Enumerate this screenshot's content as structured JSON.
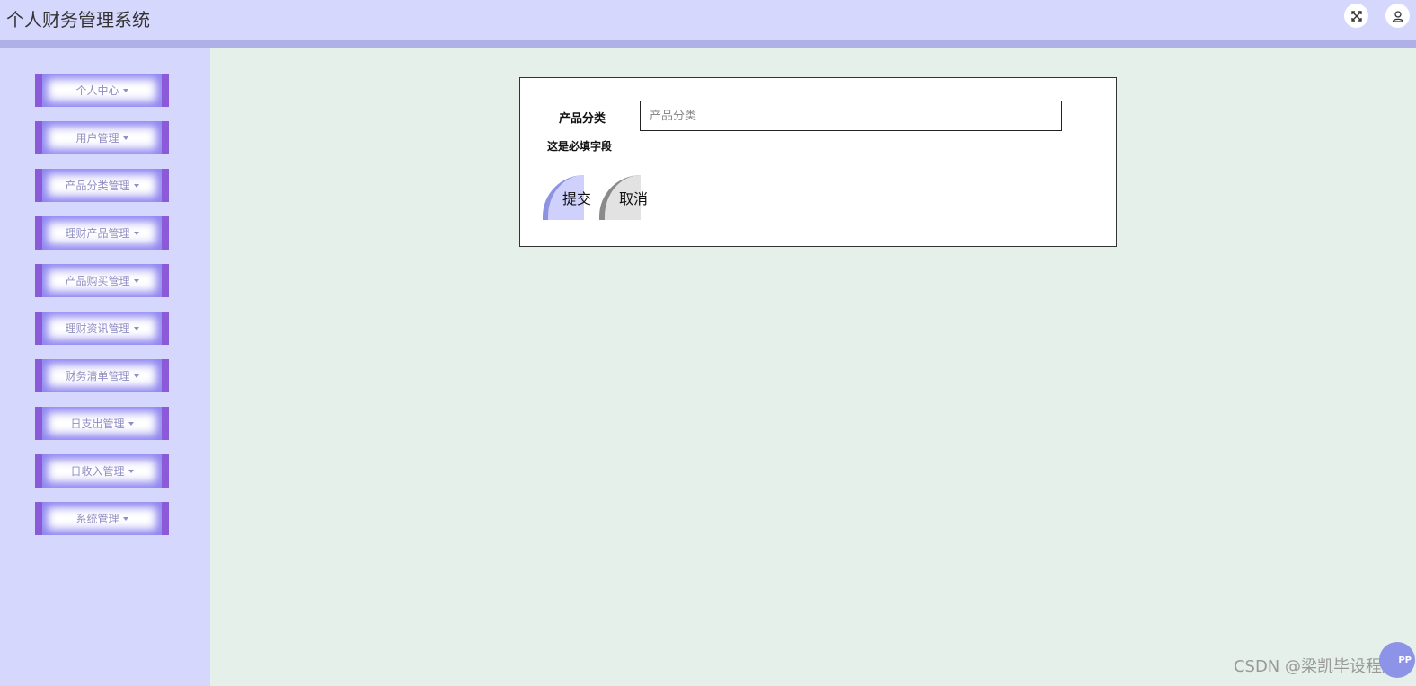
{
  "header": {
    "title": "个人财务管理系统",
    "fullscreen_icon": "fullscreen-icon",
    "user_icon": "user-icon"
  },
  "sidebar": {
    "items": [
      {
        "label": "个人中心"
      },
      {
        "label": "用户管理"
      },
      {
        "label": "产品分类管理"
      },
      {
        "label": "理财产品管理"
      },
      {
        "label": "产品购买管理"
      },
      {
        "label": "理财资讯管理"
      },
      {
        "label": "财务清单管理"
      },
      {
        "label": "日支出管理"
      },
      {
        "label": "日收入管理"
      },
      {
        "label": "系统管理"
      }
    ]
  },
  "form": {
    "category_label": "产品分类",
    "category_value": "",
    "category_placeholder": "产品分类",
    "required_hint": "这是必填字段",
    "submit_label": "提交",
    "cancel_label": "取消"
  },
  "footer": {
    "watermark": "CSDN @梁凯毕设程序",
    "float_button_label": "PP"
  },
  "colors": {
    "header_bg": "#d6d7fc",
    "header_bar": "#afb0e8",
    "content_bg": "#e6f0ea",
    "menu_accent": "#8a5ad9",
    "submit_bg": "#cfd0fb",
    "cancel_bg": "#e2e2e2"
  }
}
